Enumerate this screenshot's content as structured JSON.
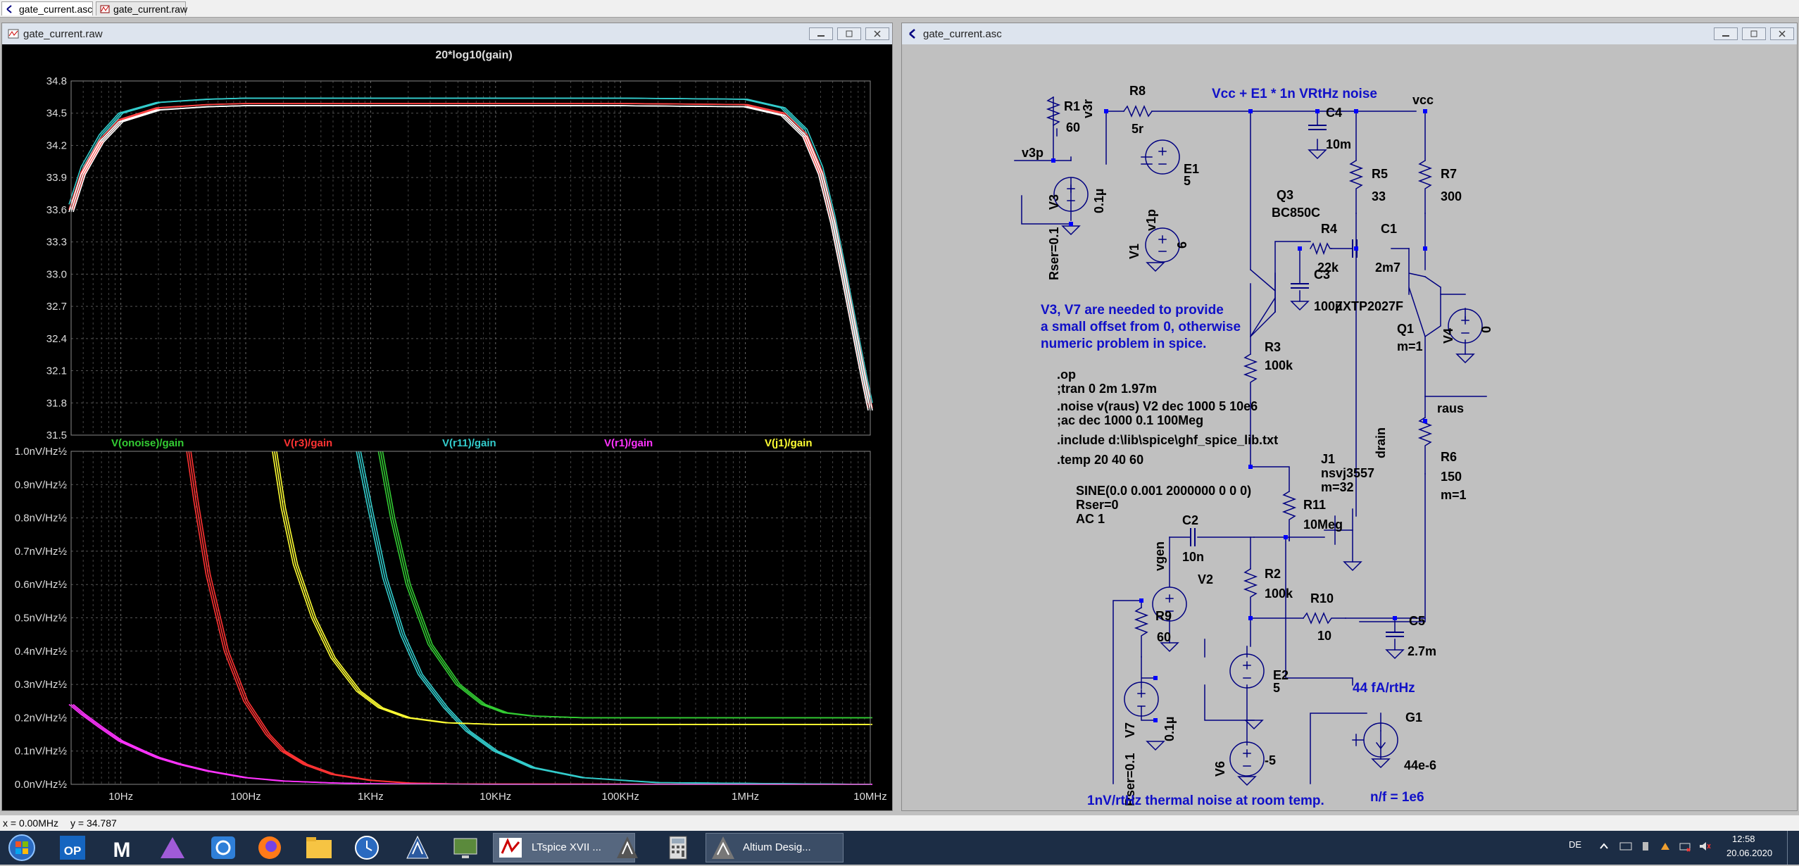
{
  "tabs": [
    {
      "label": "gate_current.asc",
      "active": true
    },
    {
      "label": "gate_current.raw",
      "active": false
    }
  ],
  "plot_window": {
    "title": "gate_current.raw"
  },
  "schematic_window": {
    "title": "gate_current.asc"
  },
  "chart_data": [
    {
      "type": "line",
      "title": "20*log10(gain)",
      "xscale": "log",
      "xlim": [
        4,
        10000000
      ],
      "ylim": [
        31.5,
        34.8
      ],
      "x_ticks": [],
      "y_ticks": [
        "34.8",
        "34.5",
        "34.2",
        "33.9",
        "33.6",
        "33.3",
        "33.0",
        "32.7",
        "32.4",
        "32.1",
        "31.8",
        "31.5"
      ],
      "y_tick_values": [
        34.8,
        34.5,
        34.2,
        33.9,
        33.6,
        33.3,
        33.0,
        32.7,
        32.4,
        32.1,
        31.8,
        31.5
      ],
      "grid": true,
      "series": [
        {
          "color": "#33cccc",
          "x": [
            4,
            5,
            7,
            10,
            20,
            50,
            100,
            1000,
            10000,
            100000,
            1000000,
            2000000,
            3000000,
            4000000,
            5000000,
            6000000,
            7000000,
            8000000,
            9000000,
            10000000
          ],
          "y": [
            33.65,
            34.0,
            34.3,
            34.5,
            34.6,
            34.63,
            34.64,
            34.64,
            34.64,
            34.64,
            34.63,
            34.55,
            34.35,
            34.0,
            33.55,
            33.1,
            32.7,
            32.35,
            32.05,
            31.8
          ]
        },
        {
          "color": "#ff4444",
          "x": [
            4,
            5,
            7,
            10,
            20,
            50,
            100,
            1000,
            10000,
            100000,
            1000000,
            2000000,
            3000000,
            4000000,
            5000000,
            6000000,
            7000000,
            8000000,
            9000000,
            10000000
          ],
          "y": [
            33.6,
            33.95,
            34.25,
            34.44,
            34.55,
            34.58,
            34.59,
            34.59,
            34.59,
            34.59,
            34.58,
            34.5,
            34.3,
            33.95,
            33.5,
            33.05,
            32.65,
            32.3,
            32.0,
            31.75
          ]
        },
        {
          "color": "#ffffff",
          "x": [
            4,
            5,
            7,
            10,
            20,
            50,
            100,
            1000,
            10000,
            100000,
            1000000,
            2000000,
            3000000,
            4000000,
            5000000,
            6000000,
            7000000,
            8000000,
            9000000,
            10000000
          ],
          "y": [
            33.58,
            33.93,
            34.23,
            34.42,
            34.53,
            34.56,
            34.57,
            34.57,
            34.57,
            34.57,
            34.56,
            34.48,
            34.28,
            33.93,
            33.48,
            33.03,
            32.63,
            32.28,
            31.98,
            31.73
          ]
        }
      ]
    },
    {
      "type": "line",
      "xscale": "log",
      "xlim": [
        4,
        10000000
      ],
      "ylim": [
        0,
        1.0
      ],
      "x_ticks": [
        "10Hz",
        "100Hz",
        "1KHz",
        "10KHz",
        "100KHz",
        "1MHz",
        "10MHz"
      ],
      "x_tick_values": [
        10,
        100,
        1000,
        10000,
        100000,
        1000000,
        10000000
      ],
      "y_ticks": [
        "1.0nV/Hz½",
        "0.9nV/Hz½",
        "0.8nV/Hz½",
        "0.7nV/Hz½",
        "0.6nV/Hz½",
        "0.5nV/Hz½",
        "0.4nV/Hz½",
        "0.3nV/Hz½",
        "0.2nV/Hz½",
        "0.1nV/Hz½",
        "0.0nV/Hz½"
      ],
      "y_tick_values": [
        1.0,
        0.9,
        0.8,
        0.7,
        0.6,
        0.5,
        0.4,
        0.3,
        0.2,
        0.1,
        0.0
      ],
      "grid": true,
      "legend_position": "top",
      "series": [
        {
          "name": "V(onoise)/gain",
          "color": "#33cc33",
          "x": [
            1200,
            1500,
            2000,
            3000,
            5000,
            8000,
            12000,
            20000,
            50000,
            200000,
            1000000,
            10000000
          ],
          "y": [
            1.0,
            0.8,
            0.6,
            0.42,
            0.3,
            0.24,
            0.215,
            0.205,
            0.2,
            0.2,
            0.2,
            0.2
          ]
        },
        {
          "name": "V(r3)/gain",
          "color": "#ff3333",
          "x": [
            35,
            40,
            50,
            70,
            100,
            150,
            200,
            300,
            500,
            1000,
            2000,
            5000,
            10000000
          ],
          "y": [
            1.0,
            0.85,
            0.63,
            0.4,
            0.25,
            0.15,
            0.1,
            0.06,
            0.03,
            0.012,
            0.004,
            0.001,
            0.0
          ]
        },
        {
          "name": "V(r11)/gain",
          "color": "#33cccc",
          "x": [
            800,
            1000,
            1300,
            1800,
            2500,
            4000,
            6000,
            10000,
            20000,
            50000,
            200000,
            10000000
          ],
          "y": [
            1.0,
            0.82,
            0.62,
            0.45,
            0.33,
            0.23,
            0.16,
            0.1,
            0.05,
            0.02,
            0.005,
            0.0
          ]
        },
        {
          "name": "V(r1)/gain",
          "color": "#ff33ff",
          "x": [
            4,
            5,
            7,
            10,
            15,
            20,
            30,
            50,
            100,
            200,
            500,
            1000,
            10000,
            10000000
          ],
          "y": [
            0.24,
            0.21,
            0.17,
            0.13,
            0.1,
            0.08,
            0.06,
            0.04,
            0.02,
            0.01,
            0.004,
            0.002,
            0.0,
            0.0
          ]
        },
        {
          "name": "V(j1)/gain",
          "color": "#ffff33",
          "x": [
            170,
            200,
            250,
            350,
            500,
            800,
            1200,
            2000,
            4000,
            10000,
            100000,
            10000000
          ],
          "y": [
            1.0,
            0.83,
            0.66,
            0.5,
            0.38,
            0.28,
            0.23,
            0.2,
            0.185,
            0.18,
            0.18,
            0.18
          ]
        }
      ]
    }
  ],
  "schematic": {
    "labels": {
      "r1": "R1",
      "r1_val": "60",
      "v3r": "v3r",
      "v3p": "v3p",
      "v3": "V3",
      "v3_val": "0.1µ",
      "v3_rser": "Rser=0.1",
      "e1": "E1",
      "e1_val": "5",
      "v1p": "v1p",
      "v1": "V1",
      "v1_val": "6",
      "r8": "R8",
      "r8_val": "5r",
      "vcc_note": "Vcc + E1 * 1n VRtHz noise",
      "vcc": "vcc",
      "c4": "C4",
      "c4_val": "10m",
      "r5": "R5",
      "r5_val": "33",
      "r7": "R7",
      "r7_val": "300",
      "q3": "Q3",
      "q3_val": "BC850C",
      "r4": "R4",
      "r4_val": "22k",
      "c1": "C1",
      "c1_val": "2m7",
      "c3": "C3",
      "c3_val": "100µ",
      "zxtp": "ZXTP2027F",
      "q1": "Q1",
      "q1_m": "m=1",
      "v4": "V4",
      "v4_val": "0",
      "note1": "V3, V7 are needed to provide",
      "note2": "a small offset from 0, otherwise",
      "note3": "numeric problem in spice.",
      "r3": "R3",
      "r3_val": "100k",
      "op": ".op",
      "tran": ";tran 0 2m 1.97m",
      "noise": ".noise v(raus) V2 dec 1000 5 10e6",
      "ac": ";ac dec 1000 0.1 100Meg",
      "include": ".include d:\\lib\\spice\\ghf_spice_lib.txt",
      "temp": ".temp 20 40 60",
      "drain": "drain",
      "raus": "raus",
      "r6": "R6",
      "r6_val": "150",
      "r6_m": "m=1",
      "j1": "J1",
      "j1_val": "nsvj3557",
      "j1_m": "m=32",
      "r11": "R11",
      "r11_val": "10Meg",
      "sine": "SINE(0.0 0.001 2000000 0 0 0)",
      "rser0": "Rser=0",
      "ac1": "AC 1",
      "c2": "C2",
      "c2_val": "10n",
      "vgen": "vgen",
      "v2": "V2",
      "r2": "R2",
      "r2_val": "100k",
      "r10": "R10",
      "r10_val": "10",
      "c5": "C5",
      "c5_val": "2.7m",
      "r9": "R9",
      "r9_val": "60",
      "e2": "E2",
      "e2_val": "5",
      "v7": "V7",
      "v7_val": "0.1µ",
      "v7_rser": "Rser=0.1",
      "v6": "V6",
      "v6_val": "-5",
      "g1_note": "44 fA/rtHz",
      "g1": "G1",
      "g1_val": "44e-6",
      "thermal": "1nV/rtHz thermal noise at room temp.",
      "nf": "n/f = 1e6"
    }
  },
  "status": {
    "x": "x = 0.00MHz",
    "y": "y = 34.787"
  },
  "taskbar": {
    "apps": [
      {
        "icon": "windows-start-icon"
      },
      {
        "icon": "op-icon",
        "label": "OP"
      },
      {
        "icon": "m-icon",
        "label": "M"
      },
      {
        "icon": "affinity-icon"
      },
      {
        "icon": "sync-icon"
      },
      {
        "icon": "firefox-icon"
      },
      {
        "icon": "folder-icon"
      },
      {
        "icon": "clock-icon"
      },
      {
        "icon": "altium-icon"
      },
      {
        "icon": "monitor-icon"
      }
    ],
    "ltspice_label": "LTspice XVII ...",
    "altium_label": "Altium Desig...",
    "lang": "DE",
    "time": "12:58",
    "date": "20.06.2020",
    "colors": {
      "bg": "#1c2d45",
      "item": "#3b4d66"
    }
  }
}
